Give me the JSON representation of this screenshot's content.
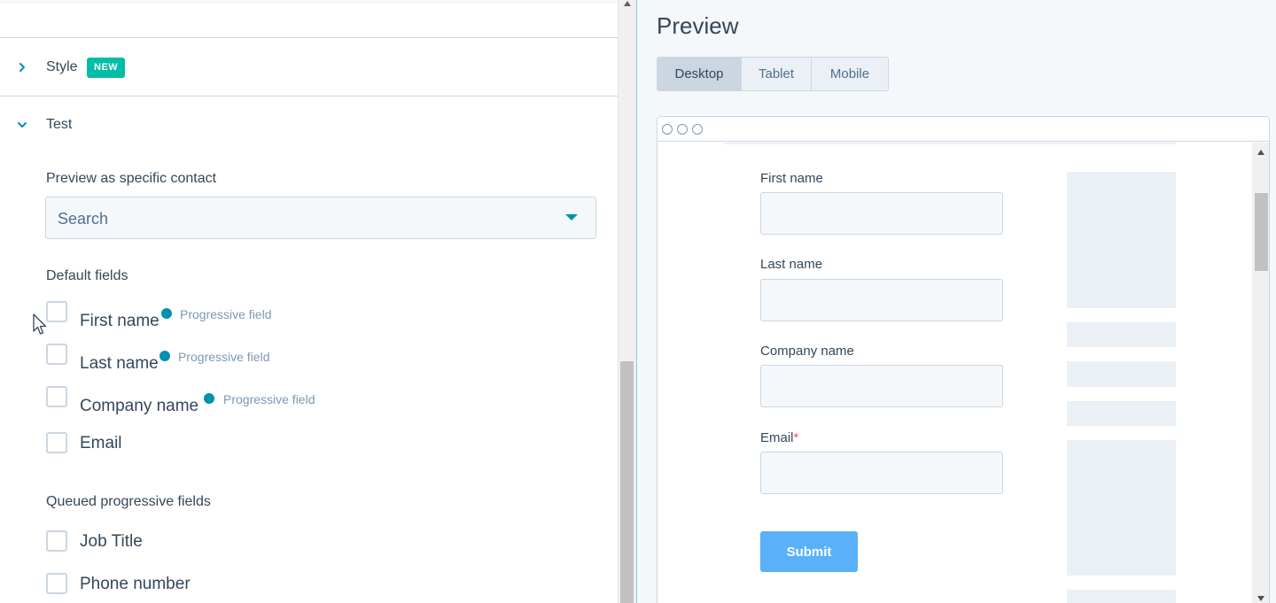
{
  "settings": {
    "style_section": {
      "title": "Style",
      "badge": "NEW",
      "expanded": false
    },
    "test_section": {
      "title": "Test",
      "expanded": true,
      "preview_contact": {
        "label": "Preview as specific contact",
        "placeholder": "Search"
      },
      "default_fields": {
        "heading": "Default fields",
        "items": [
          {
            "label": "First name",
            "checked": false,
            "tag": "Progressive field"
          },
          {
            "label": "Last name",
            "checked": false,
            "tag": "Progressive field"
          },
          {
            "label": "Company name",
            "checked": false,
            "tag": "Progressive field"
          },
          {
            "label": "Email",
            "checked": false,
            "tag": ""
          }
        ]
      },
      "queued_fields": {
        "heading": "Queued progressive fields",
        "items": [
          {
            "label": "Job Title",
            "checked": false
          },
          {
            "label": "Phone number",
            "checked": false
          }
        ]
      }
    }
  },
  "preview": {
    "title": "Preview",
    "device_tabs": [
      {
        "label": "Desktop",
        "active": true
      },
      {
        "label": "Tablet",
        "active": false
      },
      {
        "label": "Mobile",
        "active": false
      }
    ],
    "form": {
      "fields": [
        {
          "label": "First name",
          "required": false
        },
        {
          "label": "Last name",
          "required": false
        },
        {
          "label": "Company name",
          "required": false
        },
        {
          "label": "Email",
          "required": true,
          "required_mark": "*"
        }
      ],
      "submit_label": "Submit"
    }
  },
  "colors": {
    "accent": "#0091ae",
    "badge": "#00bda5",
    "submit": "#5bb1f9",
    "text": "#33475b",
    "muted": "#7c98b6",
    "required": "#f2545b"
  },
  "icons": [
    "chevron-right-icon",
    "chevron-down-icon",
    "caret-down-icon",
    "mouse-cursor-icon",
    "window-dot-icon",
    "scroll-up-arrow-icon",
    "scroll-down-arrow-icon"
  ]
}
